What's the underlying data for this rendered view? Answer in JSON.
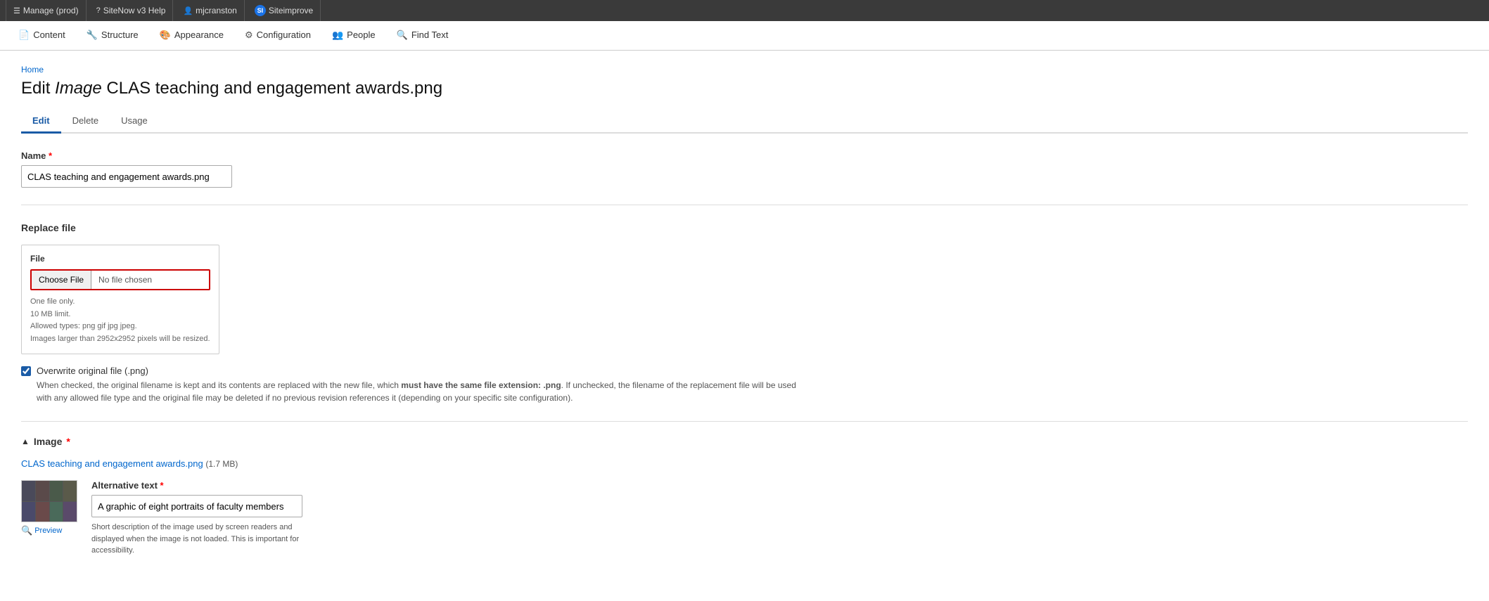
{
  "topbar": {
    "items": [
      {
        "id": "manage",
        "label": "Manage (prod)",
        "icon": "☰"
      },
      {
        "id": "sitenow-help",
        "label": "SiteNow v3 Help",
        "icon": "?"
      },
      {
        "id": "user",
        "label": "mjcranston",
        "icon": "👤"
      },
      {
        "id": "siteimprove",
        "label": "Siteimprove",
        "icon": "SI"
      }
    ]
  },
  "navbar": {
    "items": [
      {
        "id": "content",
        "label": "Content",
        "icon": "📄"
      },
      {
        "id": "structure",
        "label": "Structure",
        "icon": "🔧"
      },
      {
        "id": "appearance",
        "label": "Appearance",
        "icon": "🎨"
      },
      {
        "id": "configuration",
        "label": "Configuration",
        "icon": "⚙"
      },
      {
        "id": "people",
        "label": "People",
        "icon": "👥"
      },
      {
        "id": "find-text",
        "label": "Find Text",
        "icon": "🔍"
      }
    ]
  },
  "breadcrumb": "Home",
  "page_title_prefix": "Edit ",
  "page_title_italic": "Image",
  "page_title_suffix": " CLAS teaching and engagement awards.png",
  "tabs": [
    {
      "id": "edit",
      "label": "Edit",
      "active": true
    },
    {
      "id": "delete",
      "label": "Delete",
      "active": false
    },
    {
      "id": "usage",
      "label": "Usage",
      "active": false
    }
  ],
  "name_field": {
    "label": "Name",
    "value": "CLAS teaching and engagement awards.png",
    "placeholder": ""
  },
  "replace_file": {
    "heading": "Replace file",
    "file_label": "File",
    "choose_button": "Choose File",
    "no_file_text": "No file chosen",
    "hints": [
      "One file only.",
      "10 MB limit.",
      "Allowed types: png gif jpg jpeg.",
      "Images larger than 2952x2952 pixels will be resized."
    ],
    "overwrite_label": "Overwrite original file (.png)",
    "overwrite_checked": true,
    "overwrite_description": "When checked, the original filename is kept and its contents are replaced with the new file, which ",
    "overwrite_bold": "must have the same file extension: .png",
    "overwrite_description2": ". If unchecked, the filename of the replacement file will be used with any allowed file type and the original file may be deleted if no previous revision references it (depending on your specific site configuration)."
  },
  "image_section": {
    "heading": "Image",
    "required": true,
    "file_link": "CLAS teaching and engagement awards.png",
    "file_size": "(1.7 MB)",
    "alt_text_label": "Alternative text",
    "alt_text_value": "A graphic of eight portraits of faculty members",
    "preview_label": "Preview",
    "alt_hint": "Short description of the image used by screen readers and displayed when the image is not loaded. This is important for accessibility."
  }
}
